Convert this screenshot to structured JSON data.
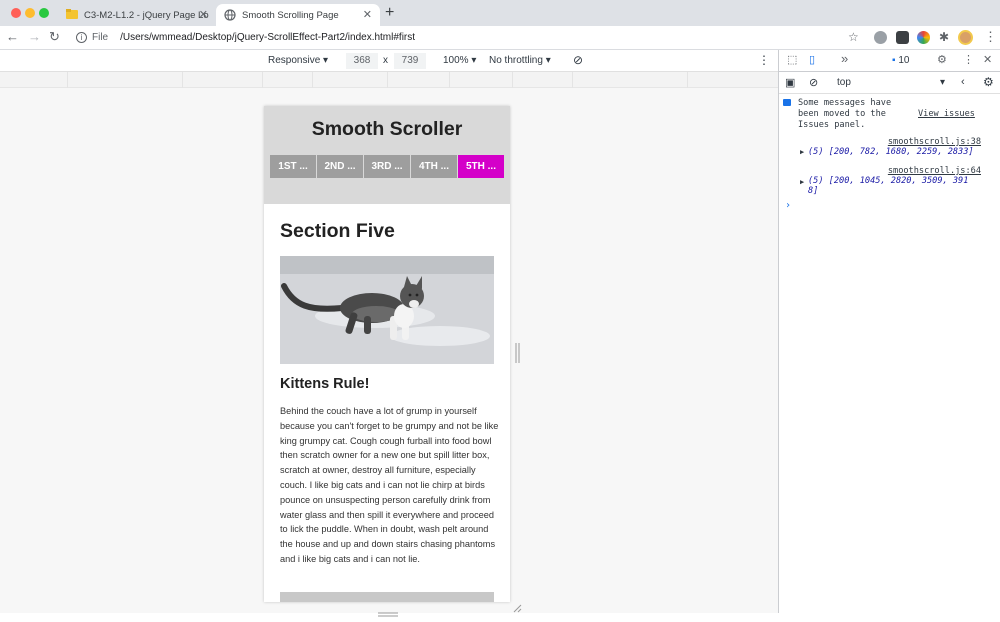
{
  "browser": {
    "tabs": [
      {
        "title": "C3-M2-L1.2 - jQuery Page Lo",
        "active": false
      },
      {
        "title": "Smooth Scrolling Page",
        "active": true
      }
    ],
    "omnibox": {
      "scheme_label": "File",
      "url": "/Users/wmmead/Desktop/jQuery-ScrollEffect-Part2/index.html#first"
    },
    "colors": {
      "tab_strip": "#dee1e6",
      "close": "#ff5f57",
      "minimize": "#febc2e",
      "maximize": "#28c840"
    }
  },
  "device_toolbar": {
    "mode": "Responsive",
    "width": "368",
    "times": "x",
    "height": "739",
    "zoom": "100%",
    "throttling": "No throttling"
  },
  "page": {
    "title": "Smooth Scroller",
    "nav": [
      {
        "label": "1ST ...",
        "active": false
      },
      {
        "label": "2ND ...",
        "active": false
      },
      {
        "label": "3RD ...",
        "active": false
      },
      {
        "label": "4TH ...",
        "active": false
      },
      {
        "label": "5TH ...",
        "active": true
      }
    ],
    "section_title": "Section Five",
    "subtitle": "Kittens Rule!",
    "body": "Behind the couch have a lot of grump in yourself because you can't forget to be grumpy and not be like king grumpy cat. Cough cough furball into food bowl then scratch owner for a new one but spill litter box, scratch at owner, destroy all furniture, especially couch. I like big cats and i can not lie chirp at birds pounce on unsuspecting person carefully drink from water glass and then spill it everywhere and proceed to lick the puddle. When in doubt, wash pelt around the house and up and down stairs chasing phantoms and i like big cats and i can not lie.",
    "accent_color": "#d400c9"
  },
  "devtools": {
    "tabs_more": "»",
    "issues_count": "10",
    "context": "top",
    "messages": {
      "notice": "Some messages have been moved to the Issues panel.",
      "notice_link": "View issues",
      "log1_source": "smoothscroll.js:38",
      "log1_value": "(5) [200, 782, 1680, 2259, 2833]",
      "log2_source": "smoothscroll.js:64",
      "log2_value_line1": "(5) [200, 1045, 2820, 3509, 391",
      "log2_value_line2": "8]",
      "prompt": "›"
    }
  }
}
